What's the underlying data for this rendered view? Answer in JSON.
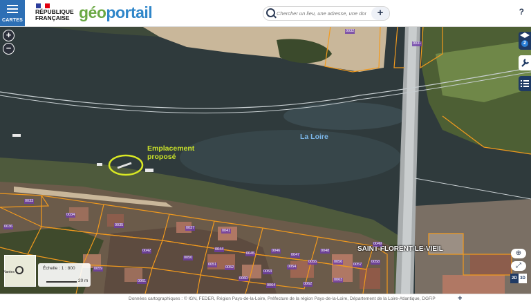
{
  "header": {
    "menu_label": "CARTES",
    "republic_line1": "RÉPUBLIQUE",
    "republic_line2": "FRANÇAISE",
    "logo_part1": "géo",
    "logo_part2": "portail",
    "search_placeholder": "Chercher un lieu, une adresse, une donnée",
    "search_add": "+",
    "help": "?"
  },
  "map": {
    "zoom_in": "+",
    "zoom_out": "−",
    "layers_count": "2",
    "label_site_line1": "Emplacement",
    "label_site_line2": "proposé",
    "label_river": "La Loire",
    "label_town": "SAINT-FLORENT-LE-VIEIL",
    "scale_label": "Échelle : 1 : 800",
    "scale_distance": "20 m",
    "minimap_label": "Nantes",
    "mode_2d": "2D",
    "mode_3d": "3D",
    "parcels": [
      "0032",
      "0031",
      "0033",
      "0034",
      "0035",
      "0036",
      "0037",
      "0041",
      "0042",
      "0044",
      "0045",
      "0046",
      "0047",
      "0048",
      "0049",
      "0050",
      "0051",
      "0052",
      "0053",
      "0054",
      "0055",
      "0056",
      "0057",
      "0058",
      "0059",
      "0060",
      "0061",
      "0062",
      "0063",
      "0064"
    ],
    "colors": {
      "water": "#2f3a3c",
      "parcel_line": "#f29a1d",
      "site_marker": "#d9e824",
      "river_label": "#7bb6e8",
      "site_label": "#c8e02a"
    }
  },
  "footer": {
    "attribution": "Données cartographiques : ©   IGN, FEDER, Région Pays-de-la-Loire, Préfecture de la région Pays-de-la-Loire, Département de la Loire-Atlantique, DGFiP",
    "expand": "+"
  }
}
